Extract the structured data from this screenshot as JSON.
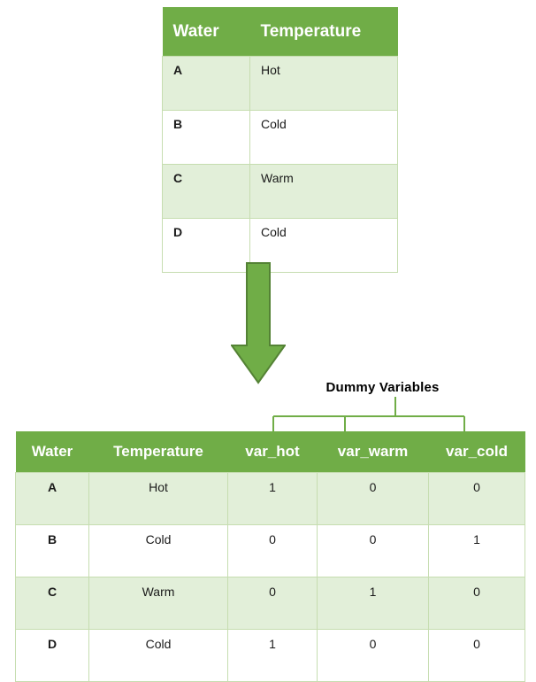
{
  "source_table": {
    "headers": [
      "Water",
      "Temperature"
    ],
    "rows": [
      {
        "water": "A",
        "temperature": "Hot"
      },
      {
        "water": "B",
        "temperature": "Cold"
      },
      {
        "water": "C",
        "temperature": "Warm"
      },
      {
        "water": "D",
        "temperature": "Cold"
      }
    ]
  },
  "annotation": {
    "dummy_label": "Dummy Variables",
    "arrow_icon": "down-arrow-icon",
    "bracket_icon": "group-bracket-icon"
  },
  "encoded_table": {
    "headers": [
      "Water",
      "Temperature",
      "var_hot",
      "var_warm",
      "var_cold"
    ],
    "rows": [
      {
        "water": "A",
        "temperature": "Hot",
        "var_hot": "1",
        "var_warm": "0",
        "var_cold": "0"
      },
      {
        "water": "B",
        "temperature": "Cold",
        "var_hot": "0",
        "var_warm": "0",
        "var_cold": "1"
      },
      {
        "water": "C",
        "temperature": "Warm",
        "var_hot": "0",
        "var_warm": "1",
        "var_cold": "0"
      },
      {
        "water": "D",
        "temperature": "Cold",
        "var_hot": "1",
        "var_warm": "0",
        "var_cold": "0"
      }
    ]
  },
  "colors": {
    "header_green": "#70AD47",
    "row_shade": "#E2EFD9",
    "border": "#C6DDB0",
    "arrow_fill": "#70AD47",
    "arrow_stroke": "#548235",
    "bracket": "#70AD47",
    "text": "#1a1a1a"
  }
}
